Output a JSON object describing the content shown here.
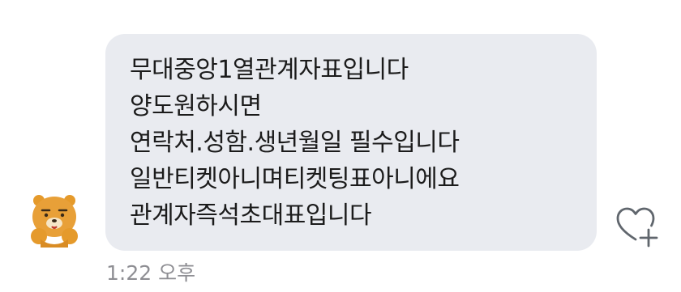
{
  "message": {
    "lines": [
      "무대중앙1열관계자표입니다",
      "양도원하시면",
      "연락처.성함.생년월일 필수입니다",
      "일반티켓아니며티켓팅표아니에요",
      "관계자즉석초대표입니다"
    ],
    "timestamp": "1:22 오후",
    "avatar_icon": "ryan-character-avatar-icon",
    "like_icon": "heart-plus-icon"
  },
  "colors": {
    "bubble": "#e9ebf0",
    "text": "#1b1b1b",
    "timestamp": "#8e8e93",
    "heart_outline": "#60666d",
    "avatar_fur": "#e59a2b"
  }
}
